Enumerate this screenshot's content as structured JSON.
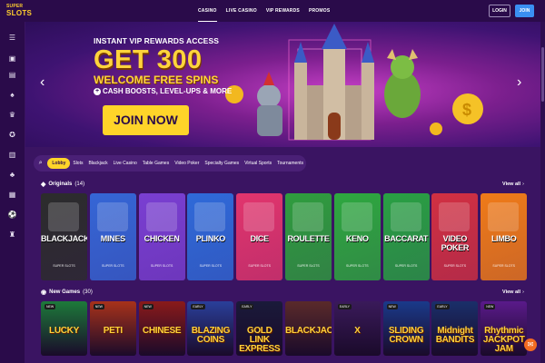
{
  "header": {
    "logo_line1": "SUPER",
    "logo_line2": "SLOTS",
    "nav": [
      "CASINO",
      "LIVE CASINO",
      "VIP REWARDS",
      "PROMOS"
    ],
    "login_label": "LOGIN",
    "join_label": "JOIN"
  },
  "hero": {
    "subtitle": "INSTANT VIP REWARDS ACCESS",
    "headline": "GET 300",
    "headline2": "WELCOME FREE SPINS",
    "perks": "CASH BOOSTS, LEVEL-UPS & MORE",
    "cta": "JOIN NOW"
  },
  "filters": {
    "active": "Lobby",
    "items": [
      "Slots",
      "Blackjack",
      "Live Casino",
      "Table Games",
      "Video Poker",
      "Specialty Games",
      "Virtual Sports",
      "Tournaments"
    ]
  },
  "originals": {
    "title": "Originals",
    "count": "(14)",
    "view_all": "View all",
    "games": [
      {
        "name": "BLACKJACK",
        "brand": "SUPER SLOTS",
        "color": "#2c2c2c"
      },
      {
        "name": "MINES",
        "brand": "SUPER SLOTS",
        "color": "#3566d6"
      },
      {
        "name": "CHICKEN",
        "brand": "SUPER SLOTS",
        "color": "#7a3fd2"
      },
      {
        "name": "PLINKO",
        "brand": "SUPER SLOTS",
        "color": "#2f6ad9"
      },
      {
        "name": "DICE",
        "brand": "SUPER SLOTS",
        "color": "#e2356d"
      },
      {
        "name": "ROULETTE",
        "brand": "SUPER SLOTS",
        "color": "#2f9d3e"
      },
      {
        "name": "KENO",
        "brand": "SUPER SLOTS",
        "color": "#2ea83f"
      },
      {
        "name": "BACCARAT",
        "brand": "SUPER SLOTS",
        "color": "#29a043"
      },
      {
        "name": "VIDEO POKER",
        "brand": "SUPER SLOTS",
        "color": "#d23042"
      },
      {
        "name": "LIMBO",
        "brand": "SUPER SLOTS",
        "color": "#f07b18"
      }
    ]
  },
  "new_games": {
    "title": "New Games",
    "count": "(30)",
    "view_all": "View all",
    "games": [
      {
        "name": "LUCKY",
        "badge": "NEW",
        "color": "#1d7a3a"
      },
      {
        "name": "PETI",
        "badge": "NEW",
        "color": "#a8321a"
      },
      {
        "name": "CHINESE",
        "badge": "NEW",
        "color": "#8a1a1a"
      },
      {
        "name": "BLAZING COINS",
        "badge": "EARLY",
        "color": "#2a3f9a"
      },
      {
        "name": "GOLD LINK EXPRESS",
        "badge": "EARLY",
        "color": "#1a1a3a"
      },
      {
        "name": "BLACKJACK",
        "badge": "",
        "color": "#5a2a2a"
      },
      {
        "name": "X",
        "badge": "EARLY",
        "color": "#3a1a5a"
      },
      {
        "name": "SLIDING CROWN",
        "badge": "NEW",
        "color": "#1a3a8a"
      },
      {
        "name": "Midnight BANDITS",
        "badge": "EARLY",
        "color": "#1a2f6a"
      },
      {
        "name": "Rhythmic JACKPOT JAM",
        "badge": "NEW",
        "color": "#5a1a8a"
      }
    ]
  },
  "colors": {
    "accent": "#ffd429",
    "join_blue": "#3a8ff2",
    "bg": "#3a1462"
  }
}
